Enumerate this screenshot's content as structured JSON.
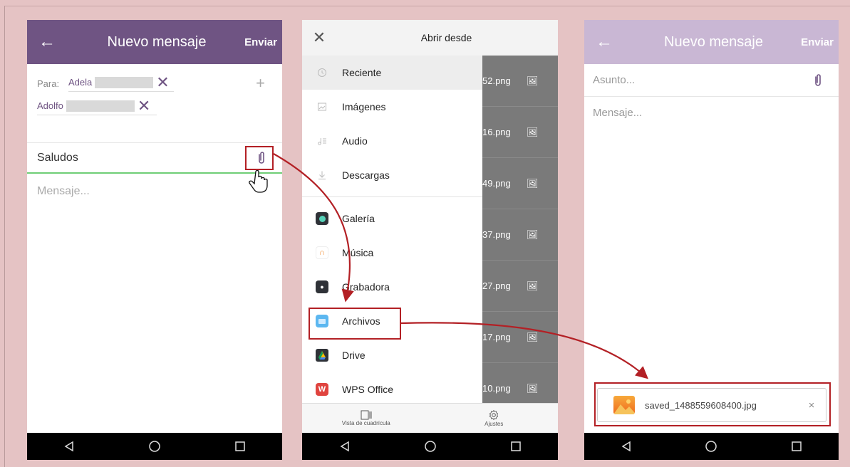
{
  "left": {
    "title": "Nuevo mensaje",
    "send": "Enviar",
    "to_label": "Para:",
    "recipient1": "Adela",
    "recipient2": "Adolfo",
    "subject": "Saludos",
    "message_placeholder": "Mensaje..."
  },
  "middle": {
    "title": "Abrir desde",
    "items": [
      "Reciente",
      "Imágenes",
      "Audio",
      "Descargas"
    ],
    "apps": [
      "Galería",
      "Música",
      "Grabadora",
      "Archivos",
      "Drive",
      "WPS Office"
    ],
    "files": [
      "52.png",
      "16.png",
      "49.png",
      "37.png",
      "27.png",
      "17.png",
      "10.png"
    ],
    "grid_view": "Vista de cuadrícula",
    "settings": "Ajustes"
  },
  "right": {
    "title": "Nuevo mensaje",
    "send": "Enviar",
    "subject_placeholder": "Asunto...",
    "message_placeholder": "Mensaje...",
    "attachment_name": "saved_1488559608400.jpg",
    "remove": "×"
  },
  "colors": {
    "background": "#e5c3c4",
    "appbar": "#6f5483",
    "appbar_faded": "#c9b7d4",
    "highlight": "#b32025",
    "focus_line": "#6fce76"
  }
}
